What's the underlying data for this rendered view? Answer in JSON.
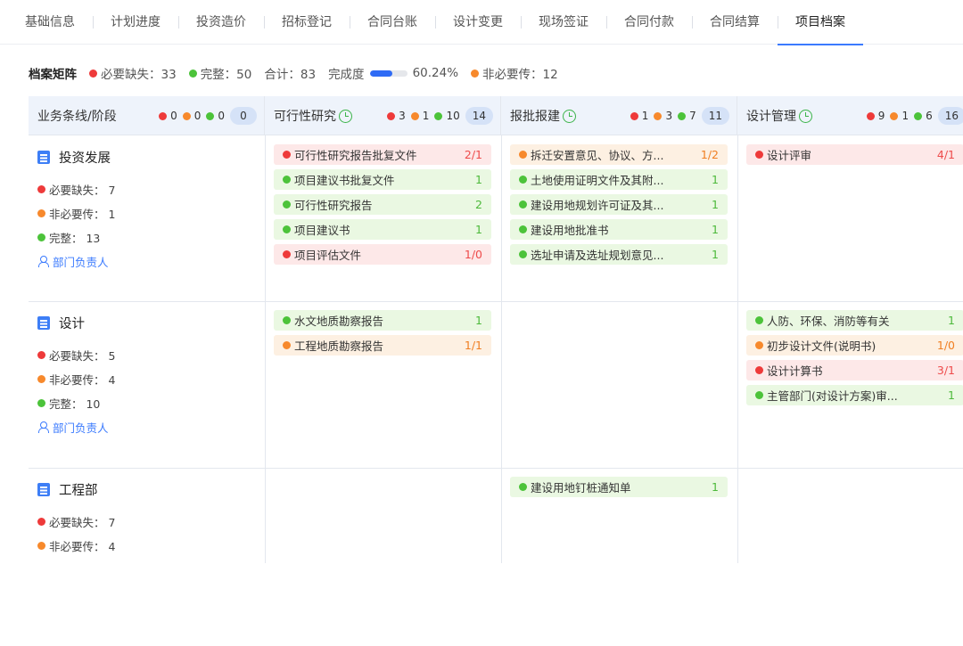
{
  "tabs": [
    {
      "label": "基础信息",
      "active": false
    },
    {
      "label": "计划进度",
      "active": false
    },
    {
      "label": "投资造价",
      "active": false
    },
    {
      "label": "招标登记",
      "active": false
    },
    {
      "label": "合同台账",
      "active": false
    },
    {
      "label": "设计变更",
      "active": false
    },
    {
      "label": "现场签证",
      "active": false
    },
    {
      "label": "合同付款",
      "active": false
    },
    {
      "label": "合同结算",
      "active": false
    },
    {
      "label": "项目档案",
      "active": true
    }
  ],
  "summary": {
    "title": "档案矩阵",
    "missing": "必要缺失：33",
    "complete": "完整：50",
    "total": "合计：83",
    "completion_label": "完成度",
    "completion_value": "60.24%",
    "completion_fraction": 0.6024,
    "optional": "非必要传：12"
  },
  "header": [
    {
      "label": "业务条线/阶段",
      "clock": false,
      "red": "0",
      "orange": "0",
      "green": "0",
      "badge": "0"
    },
    {
      "label": "可行性研究",
      "clock": true,
      "red": "3",
      "orange": "1",
      "green": "10",
      "badge": "14"
    },
    {
      "label": "报批报建",
      "clock": true,
      "red": "1",
      "orange": "3",
      "green": "7",
      "badge": "11"
    },
    {
      "label": "设计管理",
      "clock": true,
      "red": "9",
      "orange": "1",
      "green": "6",
      "badge": "16"
    }
  ],
  "units": [
    {
      "name": "投资发展",
      "missing": "必要缺失： 7",
      "optional": "非必要传： 1",
      "complete": "完整： 13",
      "owner": "部门负责人"
    },
    {
      "name": "设计",
      "missing": "必要缺失： 5",
      "optional": "非必要传： 4",
      "complete": "完整： 10",
      "owner": "部门负责人"
    },
    {
      "name": "工程部",
      "missing": "必要缺失： 7",
      "optional": "非必要传： 4",
      "complete": "",
      "owner": ""
    }
  ],
  "cells": [
    [
      [
        {
          "name": "可行性研究报告批复文件",
          "count": "2/1",
          "status": "red"
        },
        {
          "name": "项目建议书批复文件",
          "count": "1",
          "status": "green"
        },
        {
          "name": "可行性研究报告",
          "count": "2",
          "status": "green"
        },
        {
          "name": "项目建议书",
          "count": "1",
          "status": "green"
        },
        {
          "name": "项目评估文件",
          "count": "1/0",
          "status": "red"
        }
      ],
      [
        {
          "name": "拆迁安置意见、协议、方...",
          "count": "1/2",
          "status": "orange"
        },
        {
          "name": "土地使用证明文件及其附...",
          "count": "1",
          "status": "green"
        },
        {
          "name": "建设用地规划许可证及其...",
          "count": "1",
          "status": "green"
        },
        {
          "name": "建设用地批准书",
          "count": "1",
          "status": "green"
        },
        {
          "name": "选址申请及选址规划意见...",
          "count": "1",
          "status": "green"
        }
      ],
      [
        {
          "name": "设计评审",
          "count": "4/1",
          "status": "red"
        }
      ]
    ],
    [
      [
        {
          "name": "水文地质勘察报告",
          "count": "1",
          "status": "green"
        },
        {
          "name": "工程地质勘察报告",
          "count": "1/1",
          "status": "orange"
        }
      ],
      [],
      [
        {
          "name": "人防、环保、消防等有关",
          "count": "1",
          "status": "green"
        },
        {
          "name": "初步设计文件(说明书)",
          "count": "1/0",
          "status": "orange"
        },
        {
          "name": "设计计算书",
          "count": "3/1",
          "status": "red"
        },
        {
          "name": "主管部门(对设计方案)审...",
          "count": "1",
          "status": "green"
        }
      ]
    ],
    [
      [],
      [
        {
          "name": "建设用地钉桩通知单",
          "count": "1",
          "status": "green"
        }
      ],
      []
    ]
  ],
  "colors": {
    "red": "#ee3a3a",
    "orange": "#f7892c",
    "green": "#4cc33a",
    "accent": "#3a7afe"
  }
}
